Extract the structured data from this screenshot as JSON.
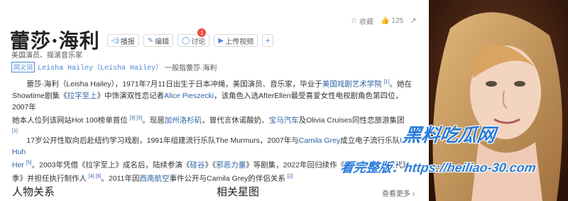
{
  "title": "蕾莎·海利",
  "actions": [
    {
      "label": "播报",
      "icon": "speaker-icon"
    },
    {
      "label": "编辑",
      "icon": "pencil-icon"
    },
    {
      "label": "讨论",
      "icon": "chat-icon",
      "badge": "1"
    },
    {
      "label": "上传视频",
      "icon": "video-icon"
    },
    {
      "label": "+",
      "icon": "plus-icon"
    }
  ],
  "toolbar": {
    "collect": "收藏",
    "likes": "125"
  },
  "subtitle": "美国演员、摇滚音乐家",
  "synonym": {
    "tag": "同义词",
    "name": "Leisha Hailey（Leisha Hailey）",
    "rest": "一般指蕾莎·海利"
  },
  "para1": {
    "line1_a": "蕾莎·海利（Leisha Hailey），1971年7月11日出生于日本冲绳，美国演员、音乐家，毕业于",
    "line1_link": "美国戏剧艺术学院",
    "line1_ref": "[1]",
    "line1_b": "。她在",
    "line2_a": "Showtime剧集《",
    "line2_link1": "拉字至上",
    "line2_b": "》中饰演双性恋记者",
    "line2_link2": "Alice Pieszecki",
    "line2_c": "，该角色入选AfterEllen最受喜爱女性电视剧角色第四位，2007年",
    "line3_a": "她本人位列该网站Hot 100榜单首位",
    "line3_refs": "[3] [5]",
    "line3_b": "。现居",
    "line3_link1": "加州洛杉矶",
    "line3_c": "，曾代言休诺酸奶、",
    "line3_link2": "宝马汽车",
    "line3_d": "及Olivia Cruises同性恋旅游集团",
    "line4_ref": "[1]"
  },
  "para2": {
    "line1_a": "17岁公开性取向后赴纽约学习戏剧，1991年组建流行乐队The Murmurs，2007年与",
    "line1_link1": "Camila Grey",
    "line1_b": "成立电子流行乐队",
    "line1_link2": "Uh Huh",
    "line2_link": "Her",
    "line2_ref": "[5]",
    "line2_a": "。2003年凭借《拉字至上》成名后，陆续参演《",
    "line2_link2": "硅谷",
    "line2_b": "》《",
    "line2_link3": "邪恶力量",
    "line2_c": "》等剧集，2022年回归续作《拉字至上：Q世代》",
    "line3_a": "季》并担任执行制作人",
    "line3_refs": "[4] [6]",
    "line3_b": "。2011年因",
    "line3_link": "西南航空",
    "line3_c": "事件公开与Camila Grey的伴侣关系",
    "line3_ref2": "[2]"
  },
  "sections": {
    "relations": "人物关系",
    "stars": "相关星图",
    "more": "查看更多 ›"
  },
  "watermark": {
    "line1": "黑料吃瓜网",
    "line2": "看完整版：https://heiliao-30.com"
  },
  "colors": {
    "link": "#2e62a6",
    "accent": "#4a8ad4",
    "badge": "#e94d3c",
    "watermark": "#2a7bd8"
  }
}
